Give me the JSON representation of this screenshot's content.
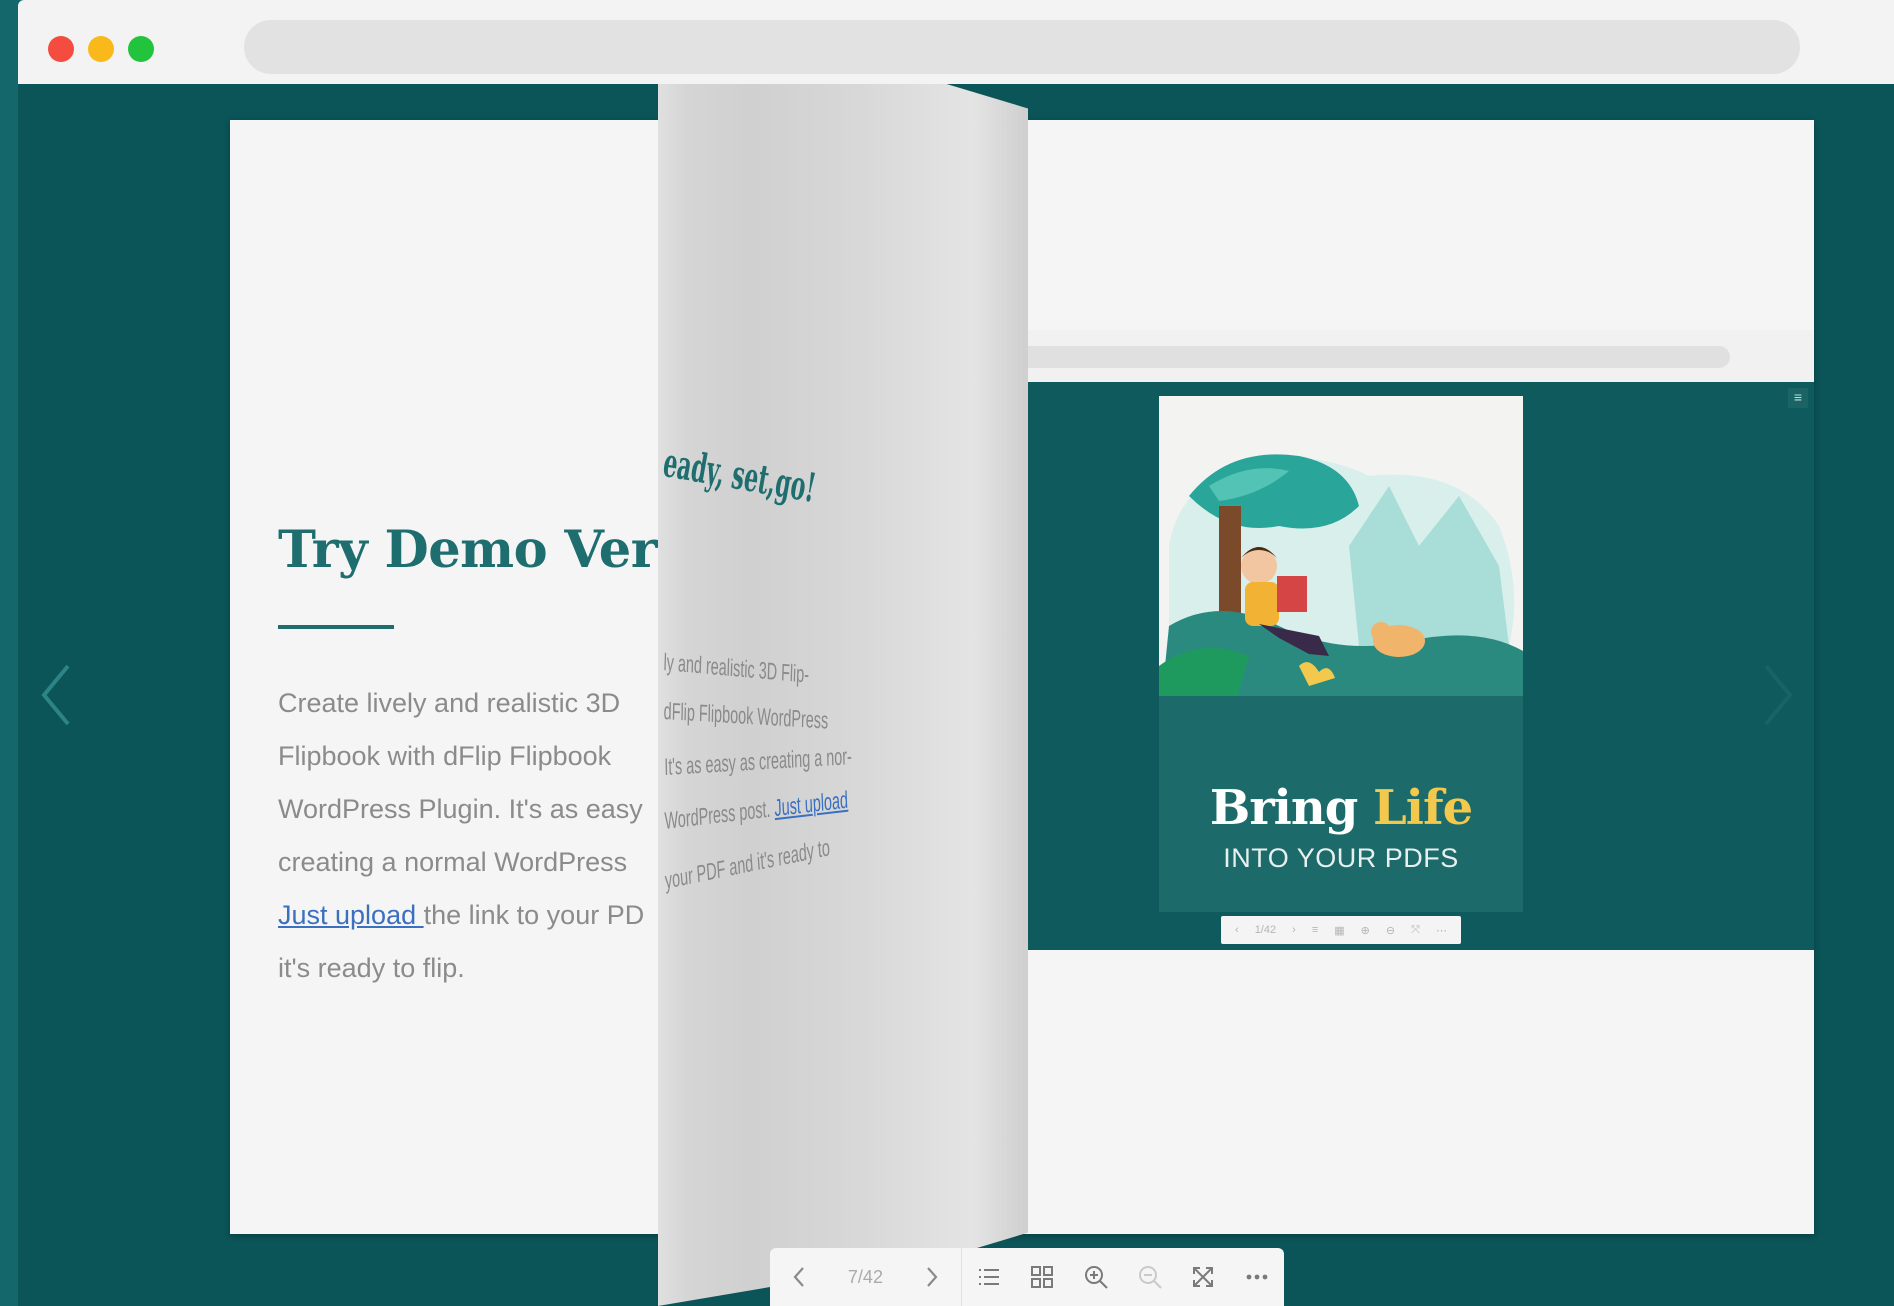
{
  "browser": {
    "window_buttons": [
      "close",
      "minimize",
      "maximize"
    ],
    "address": ""
  },
  "left_page": {
    "title": "Try Demo Versi",
    "body_lines": [
      "Create lively and realistic 3D",
      "Flipbook with dFlip Flipbook",
      "WordPress Plugin. It's as easy",
      "creating a normal WordPress"
    ],
    "link_text": "Just upload ",
    "after_link": "the link to your PD",
    "last_line": "it's ready to flip."
  },
  "turning_page": {
    "heading": "eady, set,go!",
    "lines": [
      "ly and realistic 3D Flip-",
      "dFlip Flipbook WordPress",
      "It's as easy as creating a nor-",
      "WordPress post.",
      "your PDF and it's ready to"
    ],
    "link_text": "Just upload"
  },
  "cover": {
    "title_main": "Bring ",
    "title_accent": "Life",
    "subtitle": "INTO YOUR PDFS",
    "colors": {
      "cover_bg": "#1d6a6a",
      "accent": "#f2c94c"
    }
  },
  "mini_toolbar": {
    "icons": [
      "‹",
      "1/42",
      "›",
      "≡",
      "▦",
      "⊕",
      "⊖",
      "⤧",
      "⋯"
    ]
  },
  "toolbar": {
    "page_indicator": "7/42",
    "icons": [
      "chevron-left-icon",
      "chevron-right-icon",
      "list-icon",
      "grid-icon",
      "zoom-in-icon",
      "zoom-out-icon",
      "fullscreen-icon",
      "more-icon"
    ]
  },
  "theme": {
    "stage_bg": "#0b5457",
    "accent": "#1f6e6f",
    "link": "#3b6fc0"
  }
}
